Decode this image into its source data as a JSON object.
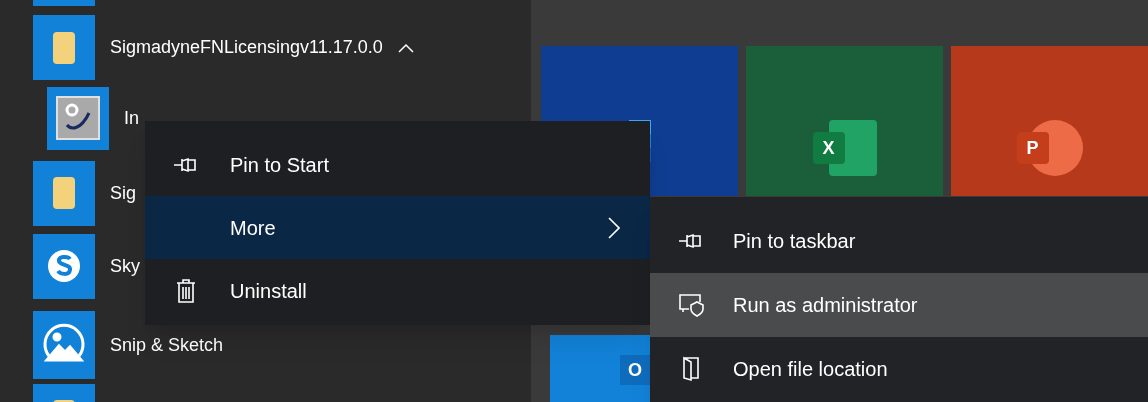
{
  "app_group": {
    "label": "SigmadyneFNLicensingv11.17.0.0",
    "expanded": true
  },
  "apps": [
    {
      "kind": "tool",
      "label": "In",
      "indented": true
    },
    {
      "kind": "folder",
      "label": "Sig",
      "indented": false
    },
    {
      "kind": "skype",
      "label": "Sky",
      "indented": false
    },
    {
      "kind": "snip",
      "label": "Snip & Sketch",
      "indented": false
    },
    {
      "kind": "folder",
      "indented": false
    }
  ],
  "tiles": [
    {
      "kind": "word",
      "color": "#0f3d91"
    },
    {
      "kind": "excel",
      "letter": "X",
      "color": "#1b5e3a"
    },
    {
      "kind": "powerpoint",
      "letter": "P",
      "color": "#b5391a"
    }
  ],
  "lower_tile": {
    "kind": "outlook",
    "letter": "O"
  },
  "context_menu": [
    {
      "kind": "pin",
      "label": "Pin to Start",
      "selected": false,
      "submenu": false
    },
    {
      "kind": "none",
      "label": "More",
      "selected": true,
      "submenu": true
    },
    {
      "kind": "trash",
      "label": "Uninstall",
      "selected": false,
      "submenu": false
    }
  ],
  "submenu": [
    {
      "kind": "pin",
      "label": "Pin to taskbar",
      "selected": false
    },
    {
      "kind": "admin",
      "label": "Run as administrator",
      "selected": true
    },
    {
      "kind": "folder",
      "label": "Open file location",
      "selected": false
    }
  ]
}
